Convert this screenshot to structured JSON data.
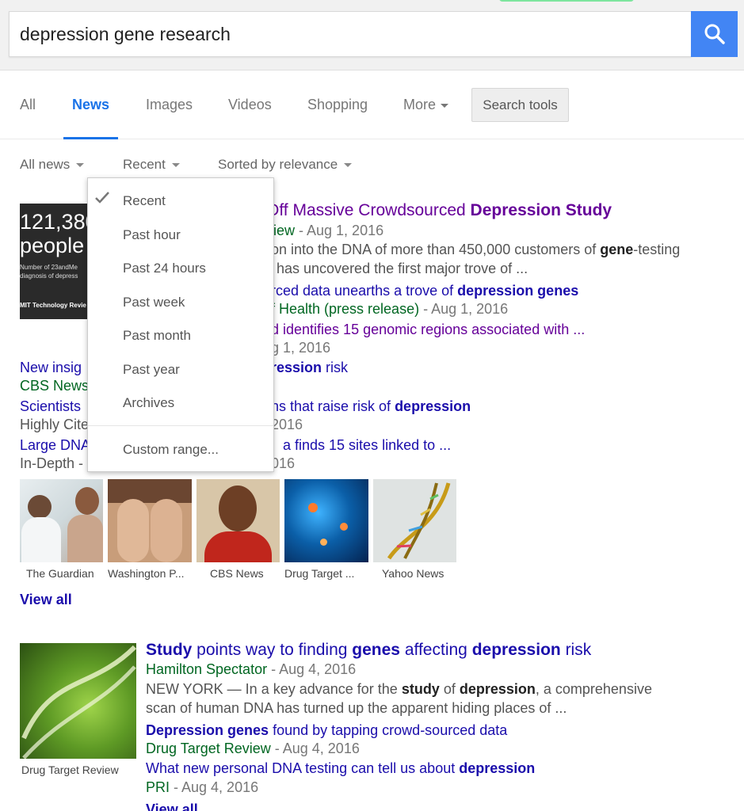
{
  "search": {
    "query": "depression gene research"
  },
  "tabs": [
    {
      "label": "All"
    },
    {
      "label": "News"
    },
    {
      "label": "Images"
    },
    {
      "label": "Videos"
    },
    {
      "label": "Shopping"
    },
    {
      "label": "More"
    }
  ],
  "search_tools_label": "Search tools",
  "filters": {
    "all_news": "All news",
    "time": "Recent",
    "sort": "Sorted by relevance"
  },
  "time_menu": {
    "items": [
      "Recent",
      "Past hour",
      "Past 24 hours",
      "Past week",
      "Past month",
      "Past year",
      "Archives"
    ],
    "custom": "Custom range..."
  },
  "result1": {
    "thumb_big": "121,380",
    "thumb_people": "people",
    "thumb_line1": "Number of 23andMe",
    "thumb_line2": "diagnosis of depress",
    "thumb_brand": "MIT Technology Revie",
    "title_pre": "Off Massive Crowdsourced ",
    "title_bold": "Depression Study",
    "source_pub": "view",
    "source_date": " - Aug 1, 2016",
    "snippet_l1_pre": "on into the DNA of more than 450,000 customers of ",
    "snippet_l1_bold": "gene",
    "snippet_l1_post": "-testing",
    "snippet_l2": "has uncovered the first major trove of ...",
    "sub1_pre": "rced data unearths a trove of ",
    "sub1_bold": "depression genes",
    "sub1_source_pub": "f Health (press release)",
    "sub1_source_date": " - Aug 1, 2016",
    "sub2_title": "d identifies 15 genomic regions associated with ...",
    "sub2_date": "g 1, 2016",
    "sub3_pre": "New insig",
    "sub3_bold": "ression",
    "sub3_post": " risk",
    "sub3_source": "CBS News",
    "sub4_pre": "Scientists",
    "sub4_mid": "ns that raise risk of ",
    "sub4_bold": "depression",
    "sub4_source": "Highly Cite",
    "sub4_date": "2016",
    "sub5_pre": "Large DNA",
    "sub5_mid": "a finds 15 sites linked to ...",
    "sub5_source": "In-Depth -",
    "sub5_date": "016",
    "images": [
      {
        "caption": "The Guardian"
      },
      {
        "caption": "Washington P..."
      },
      {
        "caption": "CBS News"
      },
      {
        "caption": "Drug Target ..."
      },
      {
        "caption": "Yahoo News"
      }
    ],
    "view_all": "View all"
  },
  "result2": {
    "title_b1": "Study",
    "title_t1": " points way to finding ",
    "title_b2": "genes",
    "title_t2": " affecting ",
    "title_b3": "depression",
    "title_t3": " risk",
    "source_pub": "Hamilton Spectator",
    "source_date": " - Aug 4, 2016",
    "snippet_l1_a": "NEW YORK — In a key advance for the ",
    "snippet_l1_b": "study",
    "snippet_l1_c": " of ",
    "snippet_l1_d": "depression",
    "snippet_l1_e": ", a comprehensive",
    "snippet_l2": "scan of human DNA has turned up the apparent hiding places of ...",
    "sub1_bold": "Depression genes",
    "sub1_rest": " found by tapping crowd-sourced data",
    "sub1_pub": "Drug Target Review",
    "sub1_date": " - Aug 4, 2016",
    "sub2_rest": "What new personal DNA testing can tell us about ",
    "sub2_bold": "depression",
    "sub2_pub": "PRI",
    "sub2_date": " - Aug 4, 2016",
    "thumb_caption": "Drug Target Review",
    "view_all": "View all"
  },
  "colors": {
    "link": "#1a0dab",
    "visited": "#660099",
    "source": "#006621",
    "accent": "#4285f4"
  }
}
